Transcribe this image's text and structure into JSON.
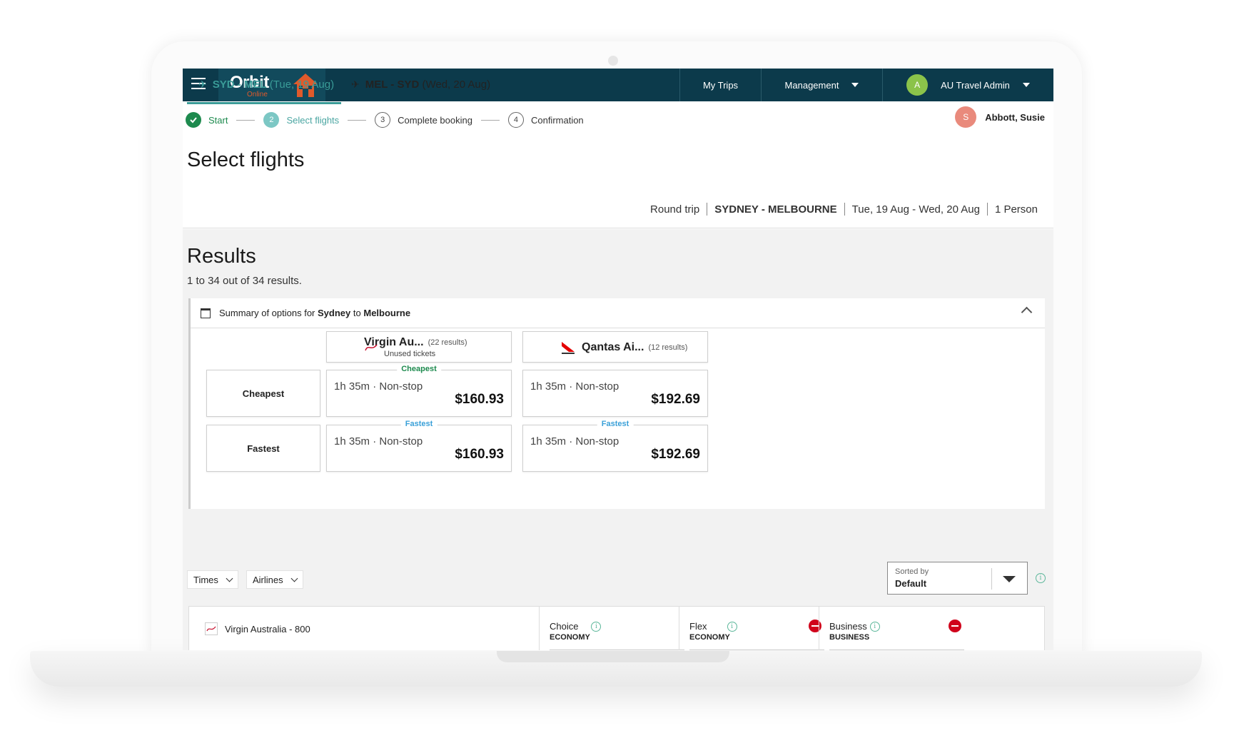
{
  "header": {
    "logo_text": "Orbit",
    "logo_sub": "Online",
    "nav": {
      "my_trips": "My Trips",
      "management": "Management",
      "user_initial": "A",
      "user_name": "AU Travel Admin"
    }
  },
  "stepper": {
    "steps": [
      {
        "num": "",
        "label": "Start",
        "state": "done"
      },
      {
        "num": "2",
        "label": "Select flights",
        "state": "active"
      },
      {
        "num": "3",
        "label": "Complete booking",
        "state": "todo"
      },
      {
        "num": "4",
        "label": "Confirmation",
        "state": "todo"
      }
    ]
  },
  "traveller": {
    "initial": "S",
    "name": "Abbott, Susie"
  },
  "page_title": "Select flights",
  "legs": {
    "outbound": {
      "route": "SYD - MEL",
      "date": "(Tue, 19 Aug)"
    },
    "return": {
      "route": "MEL - SYD",
      "date": "(Wed, 20 Aug)"
    }
  },
  "trip_summary": {
    "type": "Round trip",
    "cities": "SYDNEY - MELBOURNE",
    "dates": "Tue, 19 Aug - Wed, 20 Aug",
    "pax": "1 Person"
  },
  "results": {
    "title": "Results",
    "count": "1 to 34 out of 34 results."
  },
  "summary": {
    "prefix": "Summary of options for ",
    "origin": "Sydney",
    "mid": " to ",
    "destination": "Melbourne",
    "airlines": [
      {
        "name": "Virgin Au...",
        "count": "(22 results)",
        "sub": "Unused tickets"
      },
      {
        "name": "Qantas Ai...",
        "count": "(12 results)",
        "sub": ""
      }
    ],
    "rows": [
      {
        "label": "Cheapest",
        "cells": [
          {
            "tag": "Cheapest",
            "route": "1h 35m · Non-stop",
            "price": "$160.93"
          },
          {
            "tag": "",
            "route": "1h 35m · Non-stop",
            "price": "$192.69"
          }
        ]
      },
      {
        "label": "Fastest",
        "cells": [
          {
            "tag": "Fastest",
            "route": "1h 35m · Non-stop",
            "price": "$160.93"
          },
          {
            "tag": "Fastest",
            "route": "1h 35m · Non-stop",
            "price": "$192.69"
          }
        ]
      }
    ]
  },
  "filters": {
    "times": "Times",
    "airlines": "Airlines",
    "sort_label": "Sorted by",
    "sort_value": "Default"
  },
  "flight": {
    "airline": "Virgin Australia - 800",
    "fares": [
      {
        "name": "Choice",
        "cabin": "ECONOMY",
        "unavailable": false
      },
      {
        "name": "Flex",
        "cabin": "ECONOMY",
        "unavailable": true
      },
      {
        "name": "Business",
        "cabin": "BUSINESS",
        "unavailable": true
      }
    ]
  },
  "colors": {
    "topbar": "#0c3a4b",
    "accent_teal": "#3a9c98",
    "success_green": "#1d8a4e",
    "fastest_blue": "#3aa0d8",
    "logo_orange": "#e05a2b",
    "error_red": "#d0021b"
  },
  "icons": [
    "hamburger-icon",
    "home-icon",
    "chevron-down-icon",
    "check-icon",
    "plane-takeoff-icon",
    "plane-landing-icon",
    "calendar-icon",
    "chevron-up-icon",
    "virgin-logo-icon",
    "qantas-logo-icon",
    "info-icon",
    "unavailable-icon"
  ]
}
